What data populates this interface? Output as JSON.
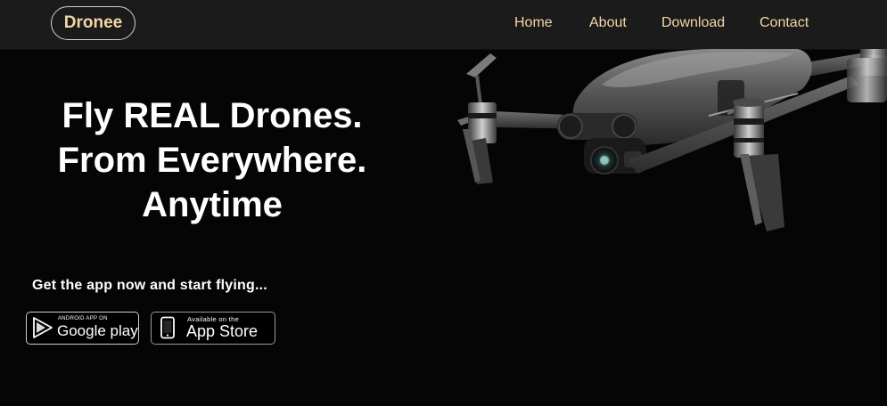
{
  "nav": {
    "logo": "Dronee",
    "links": [
      "Home",
      "About",
      "Download",
      "Contact"
    ]
  },
  "hero": {
    "title_lines": [
      "Fly REAL Drones.",
      "From Everywhere.",
      "Anytime"
    ],
    "tagline": "Get the app now and start flying..."
  },
  "badges": {
    "google": {
      "small": "ANDROID APP ON",
      "big": "Google play"
    },
    "apple": {
      "small": "Available on the",
      "big": "App Store"
    }
  },
  "colors": {
    "nav_bg": "#1b1b1b",
    "nav_text": "#f2d7a4",
    "page_bg": "#050505",
    "hero_text": "#ffffff"
  },
  "icons": [
    "play-triangle-icon",
    "smartphone-icon"
  ]
}
